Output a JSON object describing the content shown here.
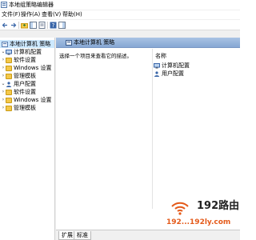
{
  "window": {
    "title": "本地组策略编辑器"
  },
  "menu": [
    {
      "label": "文件(F)"
    },
    {
      "label": "操作(A)"
    },
    {
      "label": "查看(V)"
    },
    {
      "label": "帮助(H)"
    }
  ],
  "toolbar": {
    "icons": [
      "back-icon",
      "forward-icon",
      "up-folder-icon",
      "show-hide-tree-icon",
      "properties-icon",
      "help-icon",
      "show-hide-action-pane-icon"
    ]
  },
  "tree": {
    "root": "本地计算机 策略",
    "computer": {
      "label": "计算机配置",
      "children": [
        "软件设置",
        "Windows 设置",
        "管理模板"
      ]
    },
    "user": {
      "label": "用户配置",
      "children": [
        "软件设置",
        "Windows 设置",
        "管理模板"
      ]
    }
  },
  "right": {
    "header_title": "本地计算机 策略",
    "description": "选择一个项目来查看它的描述。",
    "column_name": "名称",
    "items": [
      "计算机配置",
      "用户配置"
    ]
  },
  "tabs": [
    {
      "label": "扩展",
      "active": true
    },
    {
      "label": "标准",
      "active": false
    }
  ],
  "watermark": {
    "name": "192路由",
    "url": "192...192ly.com"
  },
  "colors": {
    "accent": "#86a7d3",
    "selection": "#cce8ff",
    "folder": "#f4c84a",
    "watermark_url": "#e45a1a"
  }
}
